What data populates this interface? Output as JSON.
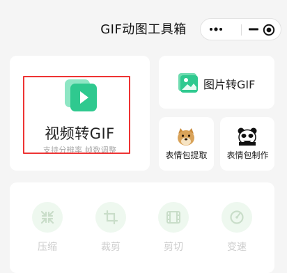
{
  "header": {
    "title": "GIF动图工具箱",
    "capsule_icons": [
      "more-dots-icon",
      "minimize-icon",
      "close-target-icon"
    ]
  },
  "main_card": {
    "label": "视频转GIF",
    "subtitle": "支持分辨率   帧数调整",
    "icon": "video-play-icon",
    "accent": "#2fc98f"
  },
  "image_card": {
    "label": "图片转GIF",
    "icon": "image-icon"
  },
  "emoji_cards": [
    {
      "label": "表情包提取",
      "icon": "doge-emoji-icon"
    },
    {
      "label": "表情包制作",
      "icon": "panda-emoji-icon"
    }
  ],
  "tools": [
    {
      "label": "压缩",
      "icon": "compress-icon"
    },
    {
      "label": "裁剪",
      "icon": "crop-icon"
    },
    {
      "label": "剪切",
      "icon": "film-cut-icon"
    },
    {
      "label": "变速",
      "icon": "speed-icon"
    }
  ],
  "colors": {
    "background": "#f5f5f5",
    "highlight_border": "#e33333",
    "tool_disabled_text": "#cdcdcd",
    "tool_icon_bg": "#eef8ef"
  }
}
